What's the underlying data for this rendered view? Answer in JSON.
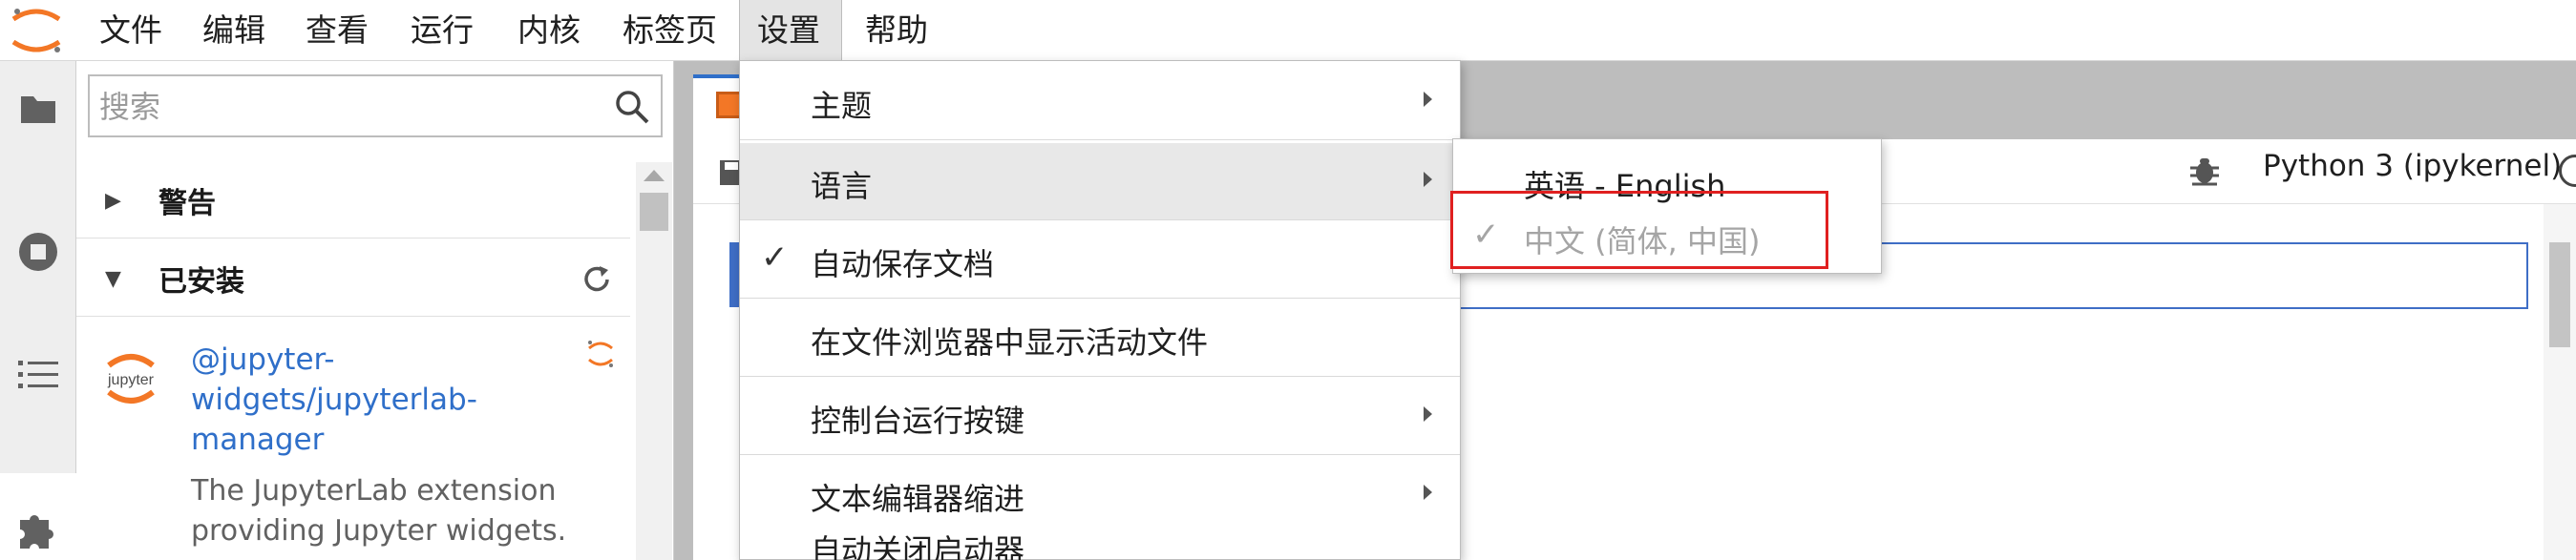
{
  "menubar": {
    "items": [
      "文件",
      "编辑",
      "查看",
      "运行",
      "内核",
      "标签页",
      "设置",
      "帮助"
    ],
    "active": "设置"
  },
  "sidebar": {
    "icons": [
      "folder-icon",
      "running-icon",
      "toc-icon",
      "extension-icon"
    ]
  },
  "extension_manager": {
    "search_placeholder": "搜索",
    "sections": [
      {
        "label": "警告",
        "expanded": false
      },
      {
        "label": "已安装",
        "expanded": true
      }
    ],
    "installed": [
      {
        "logo_text": "jupyter",
        "name": "@jupyter-widgets/jupyterlab-manager",
        "name_lines": [
          "@jupyter-",
          "widgets/jupyterlab-",
          "manager"
        ],
        "description_lines": [
          "The JupyterLab extension",
          "providing Jupyter widgets."
        ]
      }
    ]
  },
  "notebook": {
    "kernel": "Python 3 (ipykernel)"
  },
  "settings_menu": {
    "items": [
      {
        "label": "主题",
        "submenu": true,
        "checked": false,
        "highlighted": false
      },
      {
        "label": "语言",
        "submenu": true,
        "checked": false,
        "highlighted": true
      },
      {
        "label": "自动保存文档",
        "submenu": false,
        "checked": true,
        "highlighted": false
      },
      {
        "label": "在文件浏览器中显示活动文件",
        "submenu": false,
        "checked": false,
        "highlighted": false
      },
      {
        "label": "控制台运行按键",
        "submenu": true,
        "checked": false,
        "highlighted": false
      },
      {
        "label": "文本编辑器缩进",
        "submenu": true,
        "checked": false,
        "highlighted": false
      },
      {
        "label": "自动关闭启动器",
        "submenu": false,
        "checked": false,
        "highlighted": false
      }
    ]
  },
  "language_menu": {
    "items": [
      {
        "label": "英语 - English",
        "checked": false,
        "disabled": false
      },
      {
        "label": "中文 (简体, 中国)",
        "checked": true,
        "disabled": true
      }
    ]
  },
  "colors": {
    "accent": "#2f6fc9",
    "jupyter_orange": "#f37726",
    "highlight_box": "#e02020"
  }
}
